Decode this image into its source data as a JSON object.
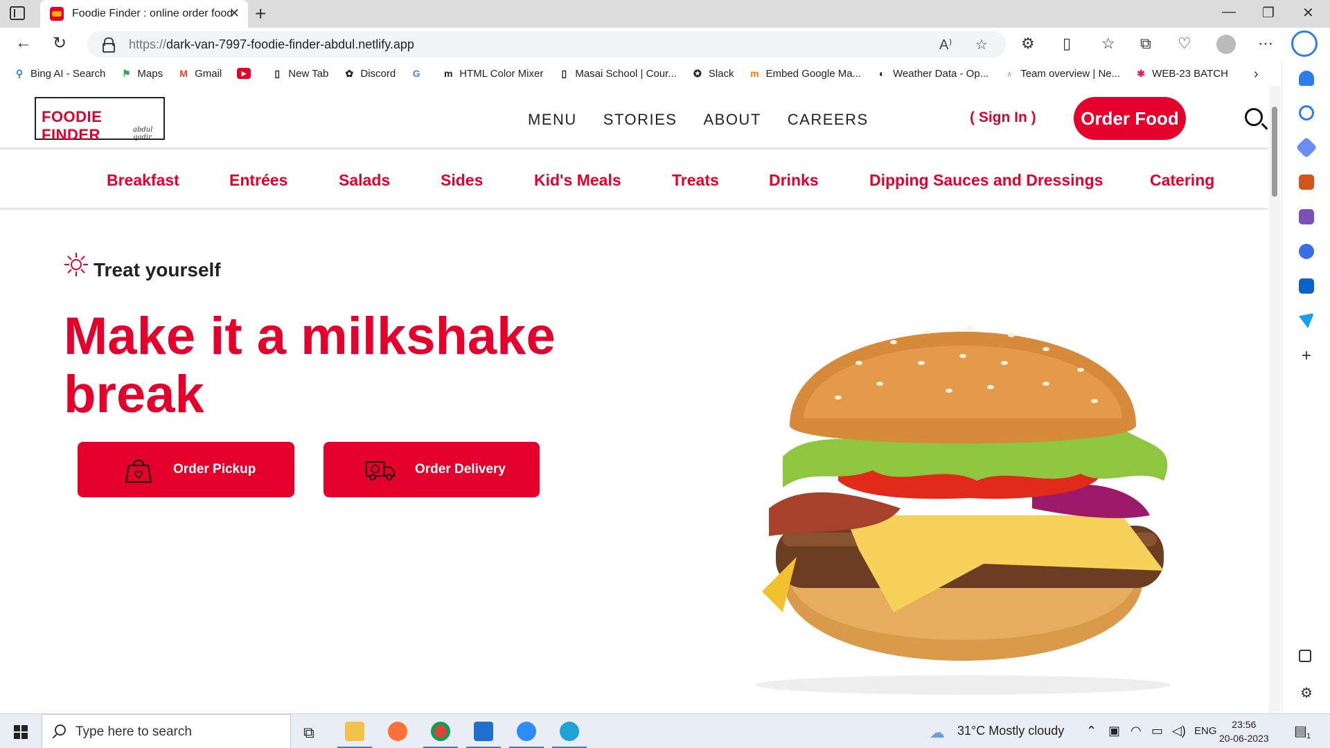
{
  "browser": {
    "tab_title": "Foodie Finder : online order food",
    "url_proto": "https://",
    "url_host": "dark-van-7997-foodie-finder-abdul.netlify.app",
    "bookmarks": [
      "Bing AI - Search",
      "Maps",
      "Gmail",
      "",
      "New Tab",
      "Discord",
      "",
      "HTML Color Mixer",
      "Masai School | Cour...",
      "Slack",
      "Embed Google Ma...",
      "Weather Data - Op...",
      "Team overview | Ne...",
      "WEB-23 BATCH"
    ]
  },
  "site": {
    "logo_text": "FOODIE FINDER",
    "logo_signature": "abdul qadir",
    "nav": [
      "MENU",
      "STORIES",
      "ABOUT",
      "CAREERS"
    ],
    "signin": "( Sign In )",
    "order_food": "Order Food",
    "categories": [
      "Breakfast",
      "Entrées",
      "Salads",
      "Sides",
      "Kid's Meals",
      "Treats",
      "Drinks",
      "Dipping Sauces and Dressings",
      "Catering"
    ],
    "tagline": "Treat yourself",
    "headline": "Make it a milkshake break",
    "order_pickup": "Order Pickup",
    "order_delivery": "Order Delivery",
    "accent_color": "#e4002b"
  },
  "taskbar": {
    "search_placeholder": "Type here to search",
    "weather": "31°C  Mostly cloudy",
    "lang": "ENG",
    "time": "23:56",
    "date": "20-06-2023",
    "notifications": "1"
  }
}
